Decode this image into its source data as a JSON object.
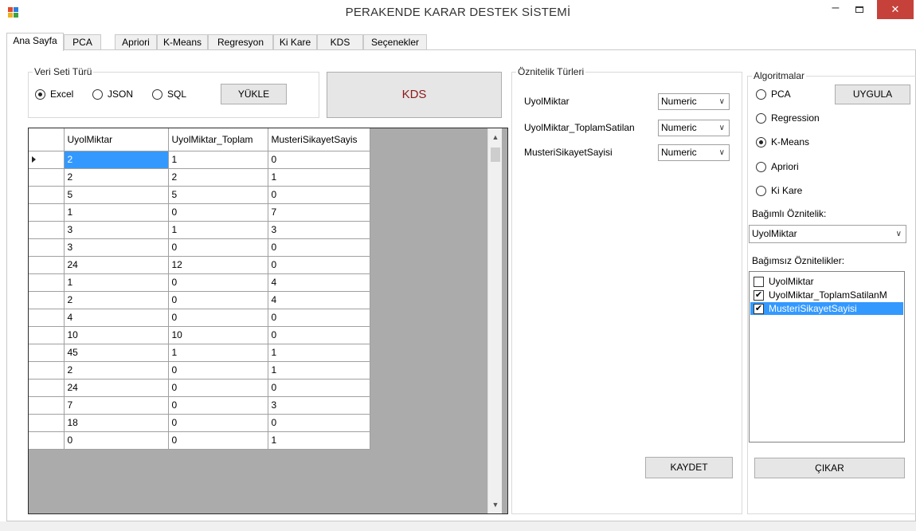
{
  "window": {
    "title": "PERAKENDE KARAR DESTEK SİSTEMİ",
    "minimize": "–",
    "close": "✕"
  },
  "tabs": [
    "Ana Sayfa",
    "PCA",
    "Apriori",
    "K-Means",
    "Regresyon",
    "Ki Kare",
    "KDS",
    "Seçenekler"
  ],
  "dataset": {
    "group_title": "Veri Seti Türü",
    "options": [
      {
        "label": "Excel",
        "selected": true
      },
      {
        "label": "JSON",
        "selected": false
      },
      {
        "label": "SQL",
        "selected": false
      }
    ],
    "load_button": "YÜKLE"
  },
  "kds_button": "KDS",
  "grid": {
    "columns": [
      "UyolMiktar",
      "UyolMiktar_Toplam",
      "MusteriSikayetSayis"
    ],
    "rows": [
      [
        "2",
        "1",
        "0"
      ],
      [
        "2",
        "2",
        "1"
      ],
      [
        "5",
        "5",
        "0"
      ],
      [
        "1",
        "0",
        "7"
      ],
      [
        "3",
        "1",
        "3"
      ],
      [
        "3",
        "0",
        "0"
      ],
      [
        "24",
        "12",
        "0"
      ],
      [
        "1",
        "0",
        "4"
      ],
      [
        "2",
        "0",
        "4"
      ],
      [
        "4",
        "0",
        "0"
      ],
      [
        "10",
        "10",
        "0"
      ],
      [
        "45",
        "1",
        "1"
      ],
      [
        "2",
        "0",
        "1"
      ],
      [
        "24",
        "0",
        "0"
      ],
      [
        "7",
        "0",
        "3"
      ],
      [
        "18",
        "0",
        "0"
      ],
      [
        "0",
        "0",
        "1"
      ]
    ]
  },
  "attribute_types": {
    "group_title": "Öznitelik Türleri",
    "rows": [
      {
        "label": "UyolMiktar",
        "type": "Numeric"
      },
      {
        "label": "UyolMiktar_ToplamSatilan",
        "type": "Numeric"
      },
      {
        "label": "MusteriSikayetSayisi",
        "type": "Numeric"
      }
    ],
    "save_button": "KAYDET"
  },
  "algorithms": {
    "group_title": "Algoritmalar",
    "options": [
      {
        "label": "PCA",
        "selected": false
      },
      {
        "label": "Regression",
        "selected": false
      },
      {
        "label": "K-Means",
        "selected": true
      },
      {
        "label": "Apriori",
        "selected": false
      },
      {
        "label": "Ki Kare",
        "selected": false
      }
    ],
    "apply_button": "UYGULA",
    "dependent_label": "Bağımlı Öznitelik:",
    "dependent_value": "UyolMiktar",
    "independent_label": "Bağımsız Öznitelikler:",
    "independent_items": [
      {
        "label": "UyolMiktar",
        "checked": false,
        "selected": false
      },
      {
        "label": "UyolMiktar_ToplamSatilanM",
        "checked": true,
        "selected": false
      },
      {
        "label": "MusteriSikayetSayisi",
        "checked": true,
        "selected": true
      }
    ],
    "remove_button": "ÇIKAR"
  },
  "colors": {
    "selection": "#3399ff",
    "close": "#c7413b",
    "kds_text": "#8b1a1a"
  }
}
